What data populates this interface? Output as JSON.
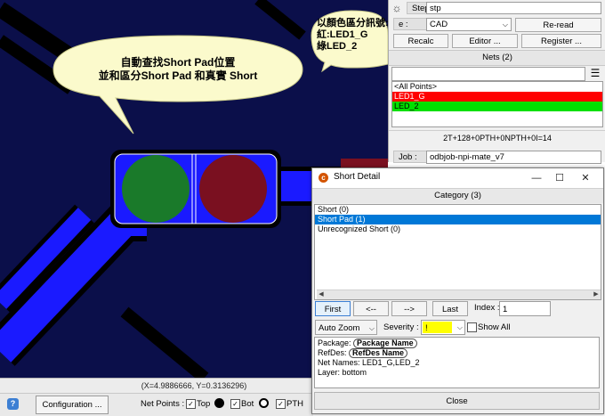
{
  "status": {
    "coords": "(X=4.9886666, Y=0.3136296)"
  },
  "toolbar": {
    "help_label": "?",
    "configuration_label": "Configuration ...",
    "net_points_label": "Net Points :",
    "top_label": "Top",
    "bot_label": "Bot",
    "pth_label": "PTH"
  },
  "right_panel": {
    "step_label": "Step :",
    "step_value": "stp",
    "source_label": "e :",
    "source_value": "CAD",
    "reread_label": "Re-read",
    "recalc_label": "Recalc",
    "editor_label": "Editor ...",
    "register_label": "Register ...",
    "nets_header": "Nets (2)",
    "nets": [
      {
        "label": "<All Points>",
        "color": "#ffffff"
      },
      {
        "label": "LED1_G",
        "color": "#ff0000"
      },
      {
        "label": "LED_2",
        "color": "#00e000"
      }
    ],
    "summary": "2T+128+0PTH+0NPTH+0I=14",
    "job_label": "Job :",
    "job_value": "odbjob-npi-mate_v7"
  },
  "callouts": {
    "left_line1": "自動查找Short Pad位置",
    "left_line2": "並和區分Short Pad 和真實 Short",
    "right_line1": "以顏色區分訊號:",
    "right_line2": "紅:LED1_G",
    "right_line3": "綠LED_2"
  },
  "dialog": {
    "title": "Short Detail",
    "category_header": "Category (3)",
    "categories": [
      {
        "label": "Short (0)",
        "selected": false
      },
      {
        "label": "Short Pad (1)",
        "selected": true
      },
      {
        "label": "Unrecognized Short (0)",
        "selected": false
      }
    ],
    "first_label": "First",
    "prev_label": "<--",
    "next_label": "-->",
    "last_label": "Last",
    "index_label": "Index :",
    "index_value": "1",
    "zoom_value": "Auto Zoom",
    "severity_label": "Severity :",
    "severity_value": "!",
    "show_all_label": "Show All",
    "package_label": "Package:",
    "package_value": "Package Name",
    "refdes_label": "RefDes:",
    "refdes_value": "RefDes Name",
    "net_names": "Net Names: LED1_G,LED_2",
    "layer": "Layer: bottom",
    "close_label": "Close"
  },
  "colors": {
    "board": "#0b0f4a",
    "trace": "#1a1aff",
    "pad_green": "#1a7a2a",
    "pad_red": "#7a1020",
    "callout": "#fbfacc",
    "selection": "#0078d7",
    "severity": "#ffff00"
  }
}
